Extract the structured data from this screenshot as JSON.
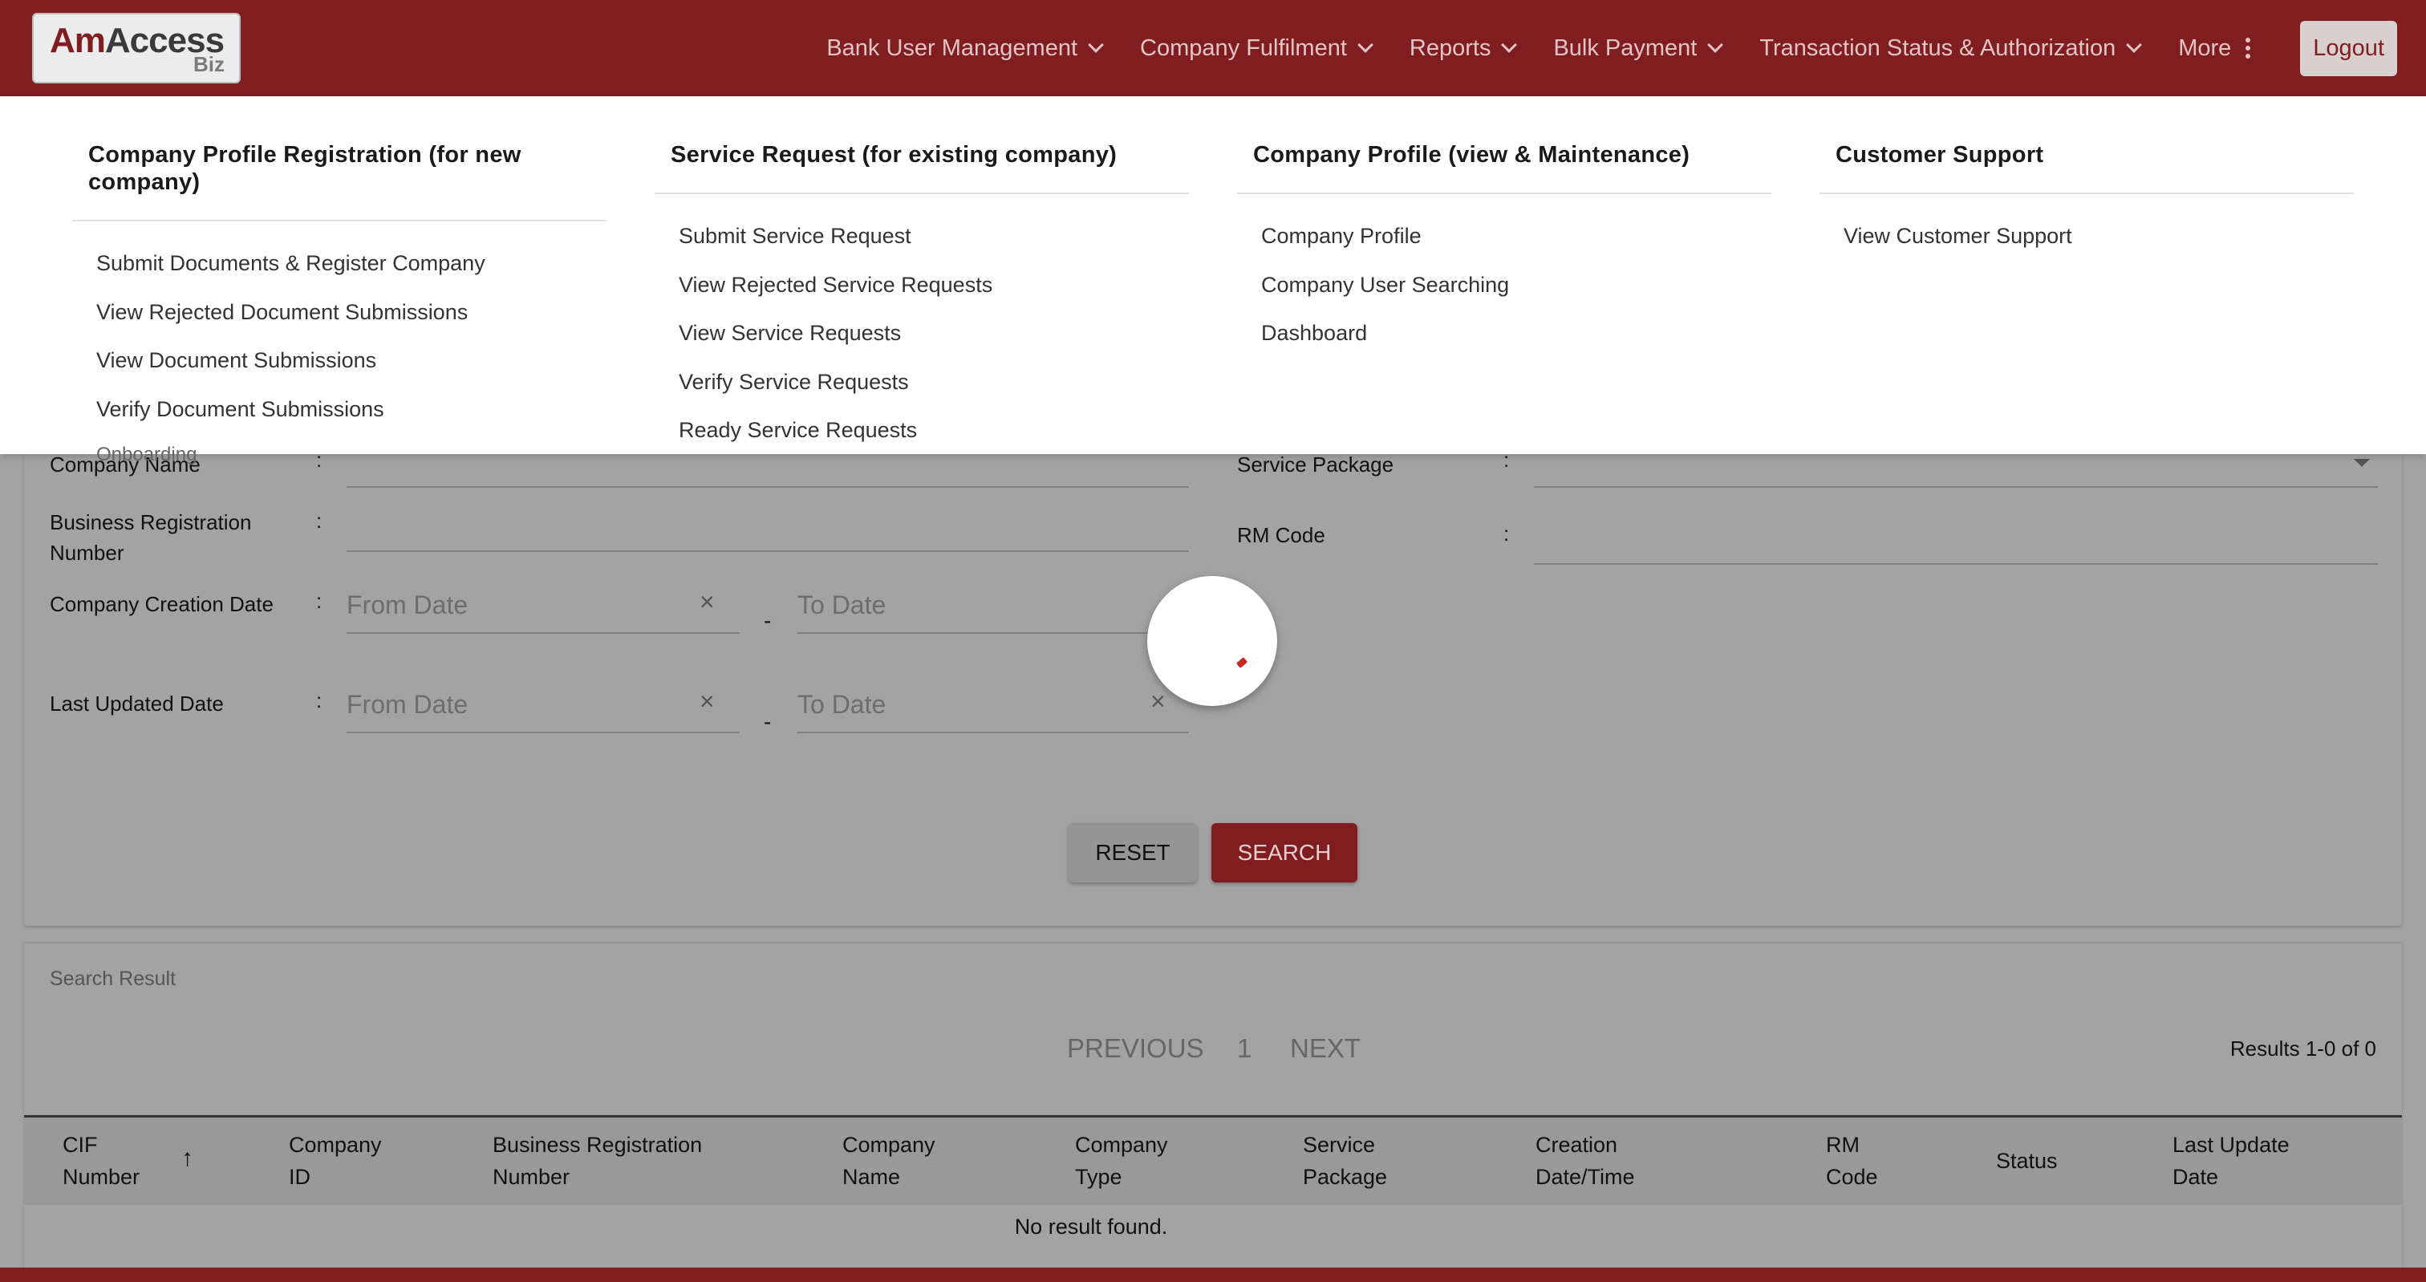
{
  "header": {
    "logo_am": "Am",
    "logo_access": "Access",
    "logo_biz": "Biz",
    "nav": [
      {
        "label": "Bank User Management"
      },
      {
        "label": "Company Fulfilment"
      },
      {
        "label": "Reports"
      },
      {
        "label": "Bulk Payment"
      },
      {
        "label": "Transaction Status & Authorization"
      }
    ],
    "more_label": "More",
    "logout_label": "Logout"
  },
  "mega_menu": {
    "columns": [
      {
        "title": "Company Profile Registration (for new company)",
        "items": [
          "Submit Documents & Register Company",
          "View Rejected Document Submissions",
          "View Document Submissions",
          "Verify Document Submissions"
        ]
      },
      {
        "title": "Service Request (for existing company)",
        "items": [
          "Submit Service Request",
          "View Rejected Service Requests",
          "View Service Requests",
          "Verify Service Requests",
          "Ready Service Requests"
        ]
      },
      {
        "title": "Company Profile (view & Maintenance)",
        "items": [
          "Company Profile",
          "Company User Searching",
          "Dashboard"
        ]
      },
      {
        "title": "Customer Support",
        "items": [
          "View Customer Support"
        ]
      }
    ],
    "ghost_text": "Onboarding"
  },
  "form": {
    "company_name_label": "Company Name",
    "service_package_label": "Service Package",
    "brn_label": "Business Registration Number",
    "rm_code_label": "RM Code",
    "creation_date_label": "Company Creation Date",
    "last_updated_label": "Last Updated Date",
    "colon": ":",
    "from_placeholder": "From Date",
    "to_placeholder": "To Date",
    "dash": "-",
    "clear_glyph": "×",
    "reset_label": "RESET",
    "search_label": "SEARCH"
  },
  "results": {
    "title": "Search Result",
    "previous_label": "PREVIOUS",
    "page_number": "1",
    "next_label": "NEXT",
    "count_text": "Results 1-0 of 0",
    "columns": [
      [
        "CIF",
        "Number"
      ],
      [
        "Company",
        "ID"
      ],
      [
        "Business Registration",
        "Number"
      ],
      [
        "Company",
        "Name"
      ],
      [
        "Company",
        "Type"
      ],
      [
        "Service",
        "Package"
      ],
      [
        "Creation",
        "Date/Time"
      ],
      [
        "RM",
        "Code"
      ],
      [
        "Status",
        ""
      ],
      [
        "Last Update",
        "Date"
      ]
    ],
    "sort_glyph": "↑",
    "empty_text": "No result found."
  },
  "colors": {
    "brand": "#7f1d21",
    "overlay_bg": "#a3a3a3"
  }
}
